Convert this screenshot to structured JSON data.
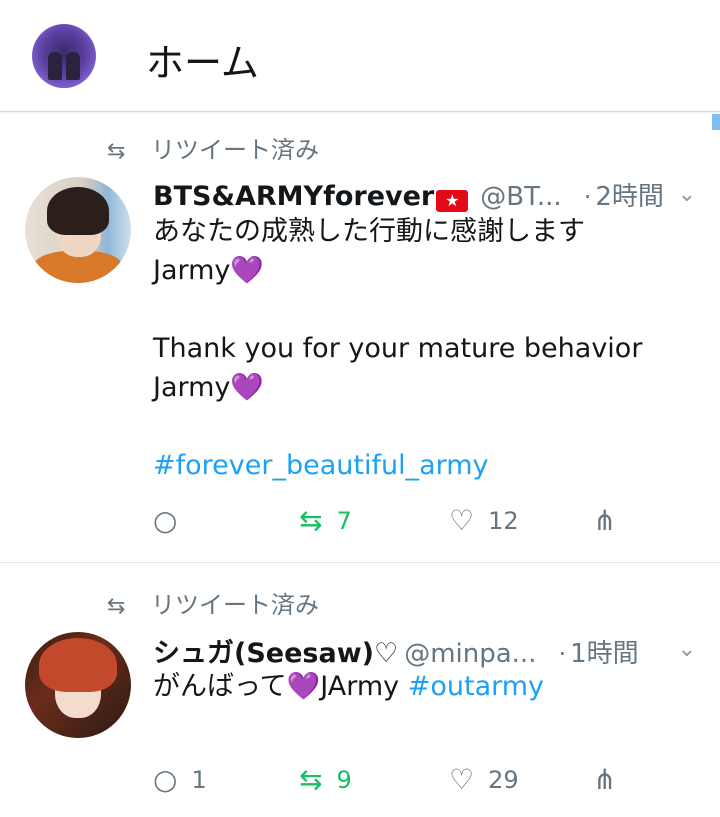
{
  "header": {
    "title": "ホーム"
  },
  "tweets": [
    {
      "retweet_label": "リツイート済み",
      "name": "BTS&ARMYforever",
      "handle": "@BT...",
      "dot": "·",
      "time": "2時間",
      "line1": "あなたの成熟した行動に感謝します",
      "line2": "Jarmy",
      "line3": "Thank you for your mature behavior",
      "line4": "Jarmy",
      "hashtag": "#forever_beautiful_army",
      "replies": "",
      "retweets": "7",
      "likes": "12"
    },
    {
      "retweet_label": "リツイート済み",
      "name": "シュガ(Seesaw)♡",
      "handle": "@minpa...",
      "dot": "·",
      "time": "1時間",
      "text_a": "がんばって",
      "text_b": "JArmy ",
      "hashtag": "#outarmy",
      "replies": "1",
      "retweets": "9",
      "likes": "29"
    }
  ],
  "icons": {
    "heart": "💜",
    "flag": "★",
    "retweet": "⇆",
    "reply": "○",
    "like": "♡",
    "share": "⋔",
    "chevron": "⌄"
  },
  "colors": {
    "accent": "#1da1f2",
    "retweet_green": "#17bf63",
    "secondary": "#66757f",
    "emoji_heart": "#7b3fe4"
  }
}
